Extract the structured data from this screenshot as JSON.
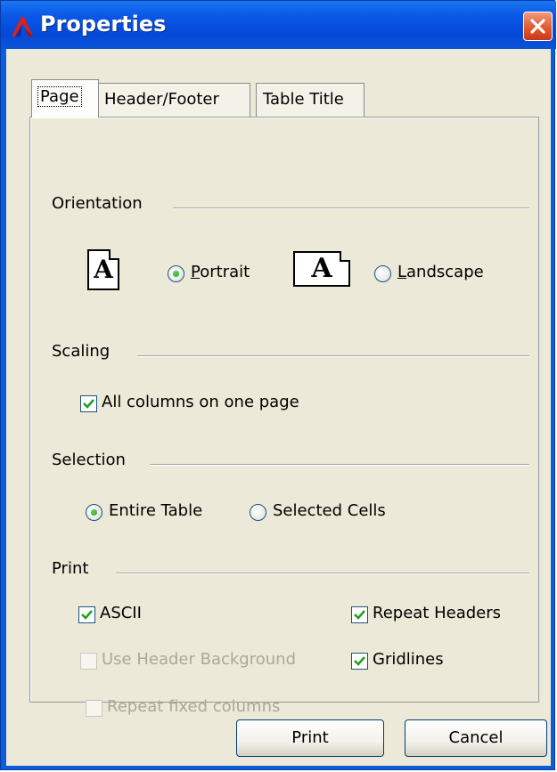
{
  "window": {
    "title": "Properties"
  },
  "tabs": [
    {
      "label": "Page",
      "active": true
    },
    {
      "label": "Header/Footer",
      "active": false
    },
    {
      "label": "Table Title",
      "active": false
    }
  ],
  "orientation": {
    "heading": "Orientation",
    "portrait_label": "Portrait",
    "landscape_label": "Landscape",
    "icon_glyph": "A",
    "selected": "Portrait"
  },
  "scaling": {
    "heading": "Scaling",
    "all_columns_label": "All columns on one page",
    "all_columns_checked": true
  },
  "selection": {
    "heading": "Selection",
    "entire_table_label": "Entire Table",
    "selected_cells_label": "Selected Cells",
    "selected": "Entire Table"
  },
  "print": {
    "heading": "Print",
    "ascii_label": "ASCII",
    "ascii_checked": true,
    "repeat_headers_label": "Repeat Headers",
    "repeat_headers_checked": true,
    "use_header_bg_label": "Use Header Background",
    "use_header_bg_checked": false,
    "use_header_bg_enabled": false,
    "gridlines_label": "Gridlines",
    "gridlines_checked": true,
    "repeat_fixed_label": "Repeat fixed columns",
    "repeat_fixed_checked": false,
    "repeat_fixed_enabled": false
  },
  "buttons": {
    "print_label": "Print",
    "cancel_label": "Cancel"
  },
  "colors": {
    "title_bar": "#0a58e6",
    "dialog_face": "#ece9d8",
    "close_button": "#e0552c",
    "check_mark": "#21a121"
  }
}
